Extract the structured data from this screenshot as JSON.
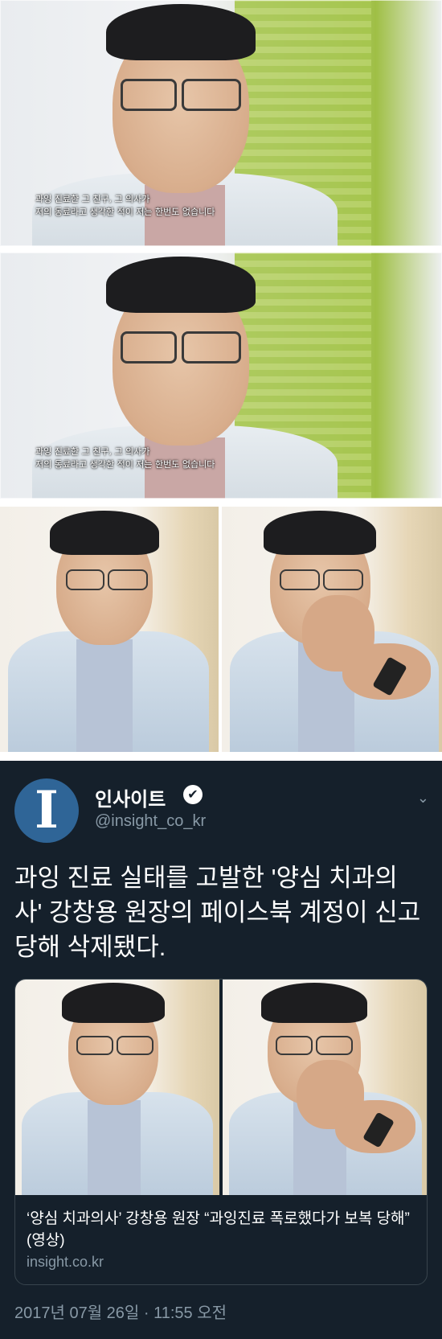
{
  "frames": [
    {
      "subtitle_line1": "과잉 진료한 그 친구, 그 의사가",
      "subtitle_line2": "저의 동료라고 생각한 적이 저는 한번도 없습니다"
    },
    {
      "subtitle_line1": "과잉 진료한 그 친구, 그 의사가",
      "subtitle_line2": "저의 동료라고 생각한 적이 저는 한번도 없습니다"
    }
  ],
  "tweet": {
    "avatar_letter": "I",
    "name": "인사이트",
    "verified_icon": "✔",
    "handle": "@insight_co_kr",
    "menu_icon": "⌄",
    "text": "과잉 진료 실태를 고발한 '양심 치과의사' 강창용 원장의 페이스북 계정이 신고 당해 삭제됐다.",
    "card": {
      "title": "‘양심 치과의사’ 강창용 원장 “과잉진료 폭로했다가 보복 당해” (영상)",
      "domain": "insight.co.kr"
    },
    "timestamp": "2017년 07월 26일 · 11:55 오전",
    "colors": {
      "background": "#15202b",
      "avatar": "#2f6597",
      "secondary": "#8899a6"
    }
  }
}
